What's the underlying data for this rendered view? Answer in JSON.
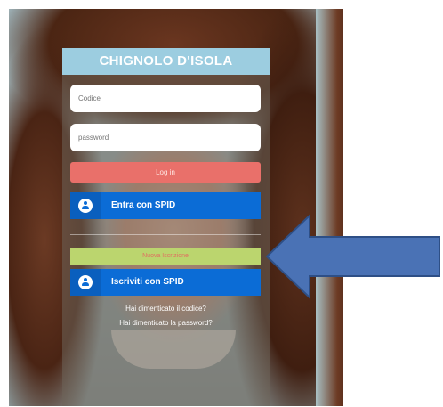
{
  "panel": {
    "title": "CHIGNOLO D'ISOLA",
    "code_placeholder": "Codice",
    "password_placeholder": "password",
    "login_label": "Log in",
    "spid_login_label": "Entra con SPID",
    "register_label": "Nuova Iscrizione",
    "spid_register_label": "Iscriviti con SPID",
    "forgot_code_link": "Hai dimenticato il codice?",
    "forgot_password_link": "Hai dimenticato la password?"
  },
  "colors": {
    "title_bar": "#9ccde0",
    "login_button": "#e9706a",
    "spid_button": "#0b6cd6",
    "register_button": "#bbd56e",
    "arrow_fill": "#4a72b5",
    "arrow_stroke": "#2e4f86"
  },
  "icons": {
    "spid": "user-circle-icon",
    "annotation": "left-arrow-icon"
  }
}
